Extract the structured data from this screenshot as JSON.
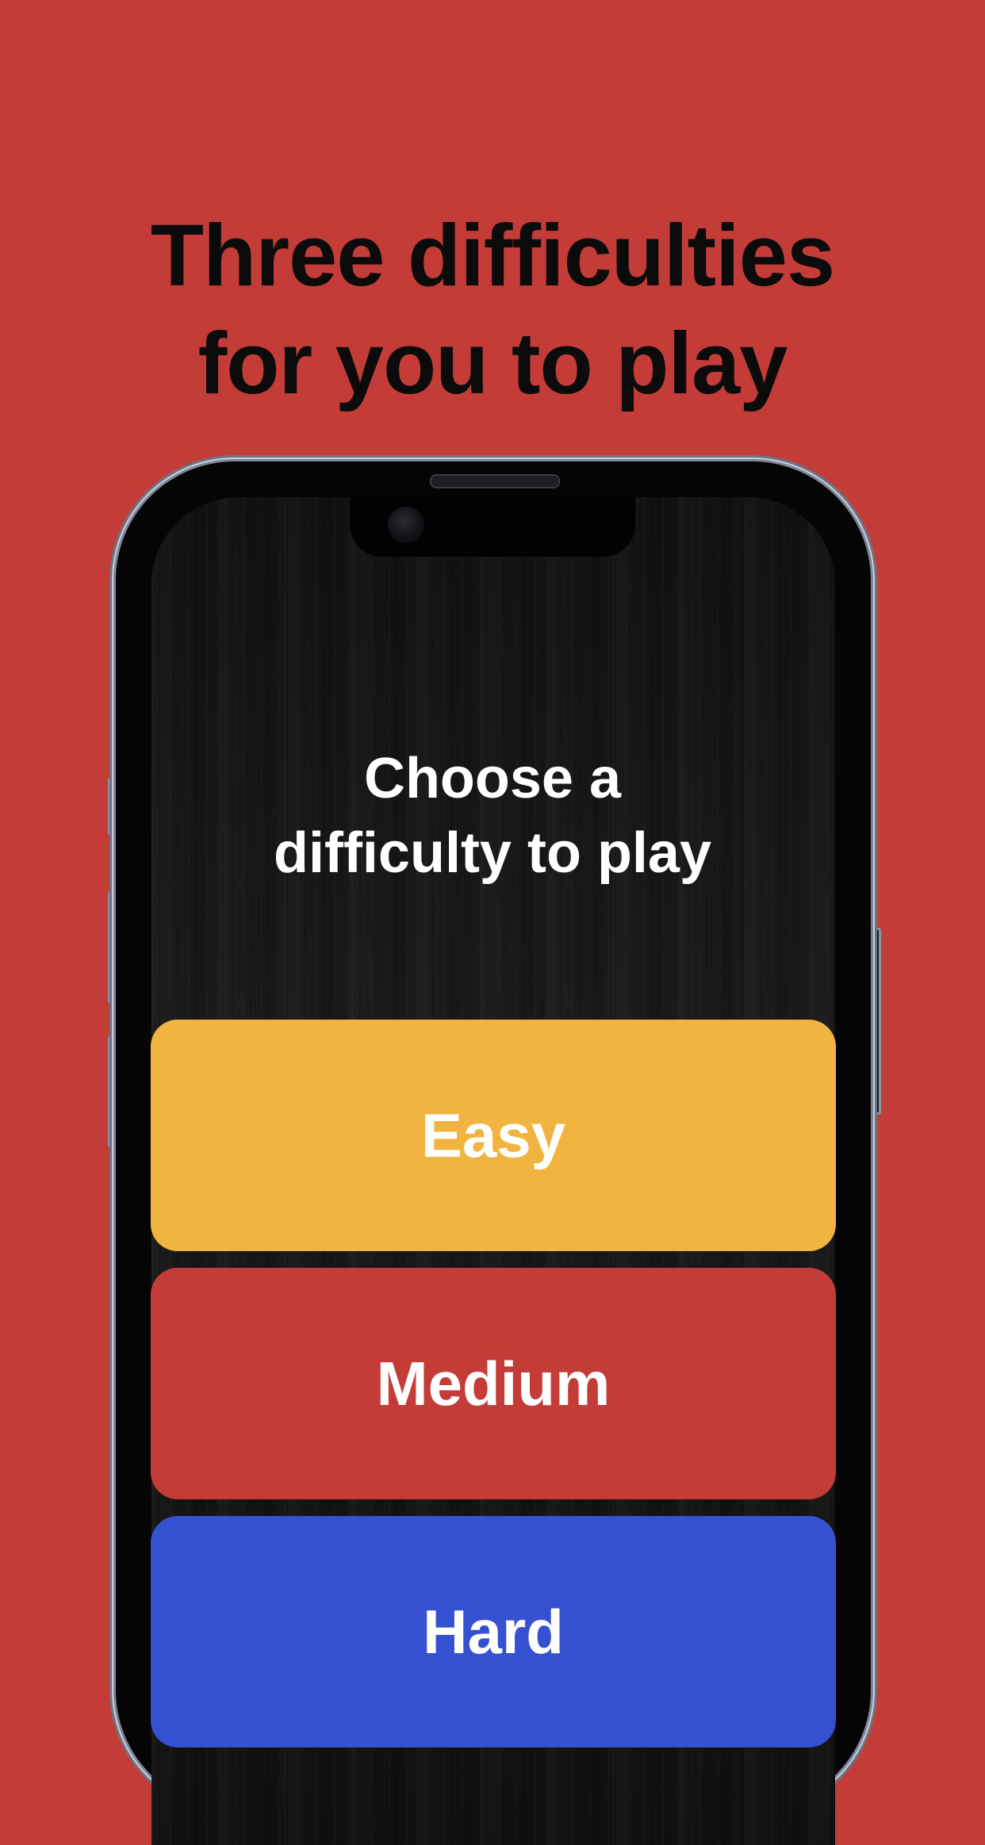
{
  "headline": {
    "line1": "Three difficulties",
    "line2": "for you to play"
  },
  "screen": {
    "prompt_line1": "Choose a",
    "prompt_line2": "difficulty to play"
  },
  "difficulties": [
    {
      "label": "Easy",
      "color": "#f2b441"
    },
    {
      "label": "Medium",
      "color": "#c43c37"
    },
    {
      "label": "Hard",
      "color": "#3650d2"
    }
  ],
  "colors": {
    "page_background": "#c43c37",
    "headline_text": "#0b0b0b",
    "screen_text": "#ffffff"
  }
}
